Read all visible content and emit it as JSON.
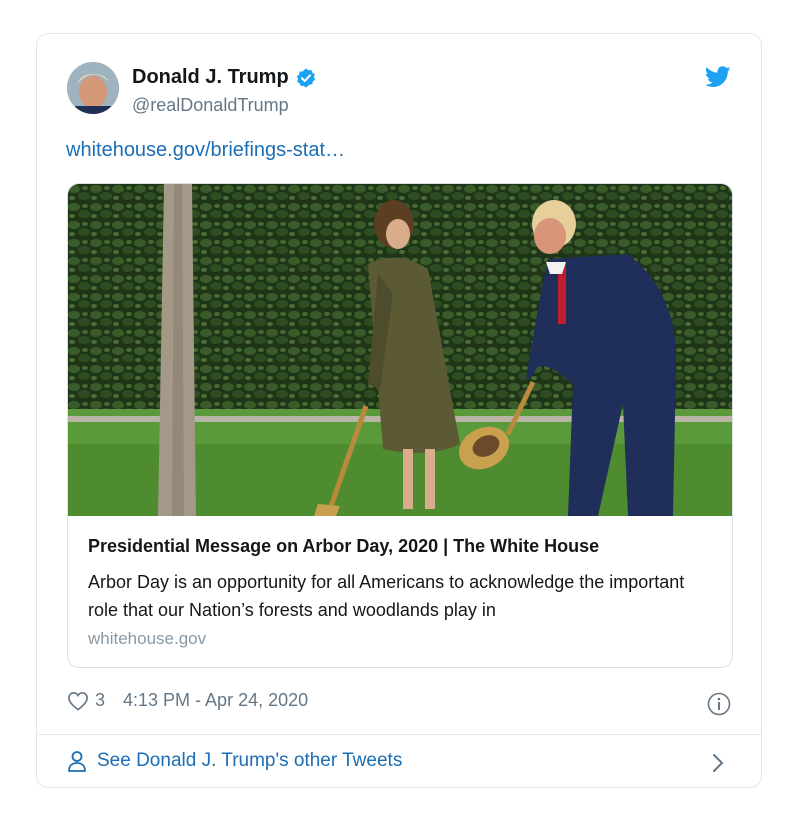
{
  "tweet": {
    "author_name": "Donald J. Trump",
    "handle": "@realDonaldTrump",
    "link_text": "whitehouse.gov/briefings-stat…"
  },
  "card": {
    "title": "Presidential Message on Arbor Day, 2020 | The White House",
    "description": "Arbor Day is an opportunity for all Americans to acknowledge the important role that our Nation’s forests and woodlands play in",
    "domain": "whitehouse.gov"
  },
  "meta": {
    "likes": "3",
    "timestamp": "4:13 PM - Apr 24, 2020"
  },
  "footer": {
    "see_more": "See Donald J. Trump's other Tweets"
  },
  "icons": {
    "verified": "verified-badge-icon",
    "bird": "twitter-bird-icon",
    "heart": "heart-icon",
    "info": "info-icon",
    "person": "person-icon",
    "chevron": "chevron-right-icon"
  },
  "colors": {
    "accent": "#1da1f2",
    "link": "#1b6eb5",
    "muted": "#657786",
    "border": "#e1e8ed"
  }
}
